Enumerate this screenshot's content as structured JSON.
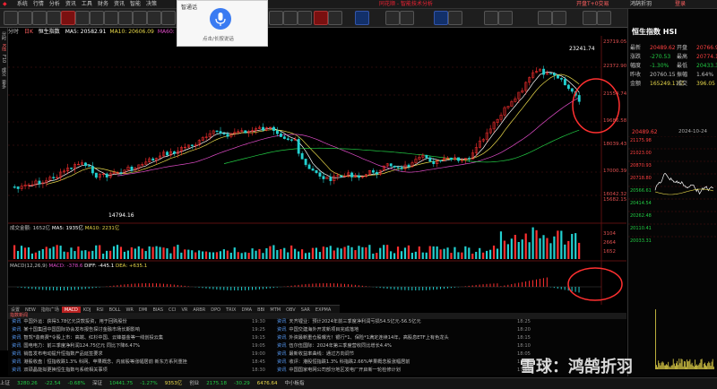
{
  "menu": {
    "items": [
      "系统",
      "行情",
      "分析",
      "资讯",
      "工具",
      "财务",
      "资讯",
      "智能",
      "决策"
    ],
    "app_title": "同花顺 - 智能技术分析",
    "right_items": [
      "开盘T+0交易",
      "鸿鹄折羽",
      "登录"
    ]
  },
  "voice": {
    "title": "智通话",
    "hint": "点击/长按说话"
  },
  "chart_header": {
    "period_tabs": [
      "分时",
      "日K"
    ],
    "index_name": "恒生指数",
    "ma_items": [
      {
        "label": "MA5: 20582.91",
        "color": "#ffffff"
      },
      {
        "label": "MA10: 20606.09",
        "color": "#e8d84a"
      },
      {
        "label": "MA60: 18611.34",
        "color": "#e04cc8"
      },
      {
        "label": "MA120: 17992.67",
        "color": "#22cc44"
      },
      {
        "label": "设置",
        "color": "#c0c0c0"
      }
    ]
  },
  "kline_price_labels": {
    "high": "23241.74",
    "low": "14794.16"
  },
  "y_axis_main": [
    "23719.05",
    "22372.90",
    "21554.74",
    "19686.58",
    "18039.43",
    "17000.39",
    "16042.32",
    "15682.15"
  ],
  "volume_header": {
    "label": "成交金额: 1652亿",
    "ma5": "MA5: 1935亿",
    "ma10": "MA10: 2231亿"
  },
  "volume_axis": [
    "3104",
    "2664",
    "1652"
  ],
  "macd_header": {
    "label": "MACD(12,26,9)",
    "macd": "MACD: -378.6",
    "diff": "DIFF: -445.1",
    "dea": "DEA: +635.1"
  },
  "indicator_tabs": [
    "设置",
    "NEW",
    "指标广场",
    "MACD",
    "KDJ",
    "RSI",
    "BOLL",
    "WR",
    "DMI",
    "BIAS",
    "CCI",
    "VR",
    "ARBR",
    "DPO",
    "TRIX",
    "DMA",
    "BBI",
    "MTM",
    "OBV",
    "SAR",
    "EXPMA"
  ],
  "indicator_active": "MACD",
  "news_bar": "指数新闻",
  "news": [
    {
      "tag": "资讯",
      "text": "中国外运：获得3.78亿元贷款投资，用于回购股份",
      "time": "19:30"
    },
    {
      "tag": "资讯",
      "text": "某十国集团中国国际协会发布报告探讨金融市场长期影响",
      "time": "19:25"
    },
    {
      "tag": "资讯",
      "text": "智驾*造商费*令股上市：高端、红杉中国、云锋基金等一线创投云集",
      "time": "19:15"
    },
    {
      "tag": "资讯",
      "text": "国电电力：前三季度净利润124.75亿元 同比下降6.47%",
      "time": "19:05"
    },
    {
      "tag": "资讯",
      "text": "销售发布电动提升恒指数产品延签要求",
      "time": "19:00"
    },
    {
      "tag": "资讯",
      "text": "港股收盘｜恒指收跌1.3% 科网、苹果概念、内房股等涨幅居前 新东方系列重挫",
      "time": "18:45"
    },
    {
      "tag": "资讯",
      "text": "双硕晶能拟更换恒生指数与系统相关事项",
      "time": "18:30"
    },
    {
      "tag": "资讯",
      "text": "天齐锂业：预计2024年前三季度净利润亏损54.5亿元-56.5亿元",
      "time": "18:25"
    },
    {
      "tag": "资讯",
      "text": "中国交建海外开发新项目完成落地",
      "time": "18:20"
    },
    {
      "tag": "资讯",
      "text": "外资最新重仓股曝光！银行*1、保险*1满定连续14年，高股息ETF上有色龙头",
      "time": "18:15"
    },
    {
      "tag": "资讯",
      "text": "伍尔伍国际：2024年第三季度营收同比增长4.4%",
      "time": "18:10"
    },
    {
      "tag": "资讯",
      "text": "最新收益率曲线：通过方向调节",
      "time": "18:05"
    },
    {
      "tag": "资讯",
      "text": "收评：港股恒指跌1.3% 科指跌2.66%苹果概念股涨幅居前",
      "time": "17:55"
    },
    {
      "tag": "资讯",
      "text": "中国国家电网公司部分地区发电厂开启新一轮检修计划",
      "time": "17:50"
    }
  ],
  "status_bar": [
    {
      "text": "上证",
      "color": "#c0c0c0"
    },
    {
      "text": "3280.26",
      "color": "#22cc44"
    },
    {
      "text": "-22.54",
      "color": "#22cc44"
    },
    {
      "text": "-0.68%",
      "color": "#22cc44"
    },
    {
      "text": "深证",
      "color": "#c0c0c0"
    },
    {
      "text": "10441.75",
      "color": "#22cc44"
    },
    {
      "text": "-1.27%",
      "color": "#22cc44"
    },
    {
      "text": "9353亿",
      "color": "#e8d84a"
    },
    {
      "text": "创业",
      "color": "#c0c0c0"
    },
    {
      "text": "2175.18",
      "color": "#22cc44"
    },
    {
      "text": "-30.29",
      "color": "#22cc44"
    },
    {
      "text": "6476.64",
      "color": "#e8d84a"
    },
    {
      "text": "中小板指",
      "color": "#c0c0c0"
    }
  ],
  "quote": {
    "title": "恒生指数 HSI",
    "rows": [
      {
        "k": "最新",
        "v": "20489.62",
        "vc": "#ff4040",
        "k2": "开盘",
        "v2": "20766.98",
        "vc2": "#ff4040"
      },
      {
        "k": "涨跌",
        "v": "-270.53",
        "vc": "#22cc44",
        "k2": "最高",
        "v2": "20774.13",
        "vc2": "#ff4040"
      },
      {
        "k": "幅度",
        "v": "-1.30%",
        "vc": "#22cc44",
        "k2": "最低",
        "v2": "20433.36",
        "vc2": "#22cc44"
      },
      {
        "k": "昨收",
        "v": "20760.15",
        "vc": "#c0c0c0",
        "k2": "振幅",
        "v2": "1.64%",
        "vc2": "#c0c0c0"
      },
      {
        "k": "金额",
        "v": "165249.17亿",
        "vc": "#e8d84a",
        "k2": "成交",
        "v2": "396.05",
        "vc2": "#e8d84a"
      }
    ],
    "last_price": "20489.62",
    "date": "2024-10-24",
    "intraday_axis": [
      "21175.98",
      "21023.00",
      "20870.93",
      "20718.80",
      "20566.61",
      "20414.54",
      "20262.48",
      "20110.41",
      "20033.31"
    ]
  },
  "watermark": "雪球：鸿鹄折羽"
}
